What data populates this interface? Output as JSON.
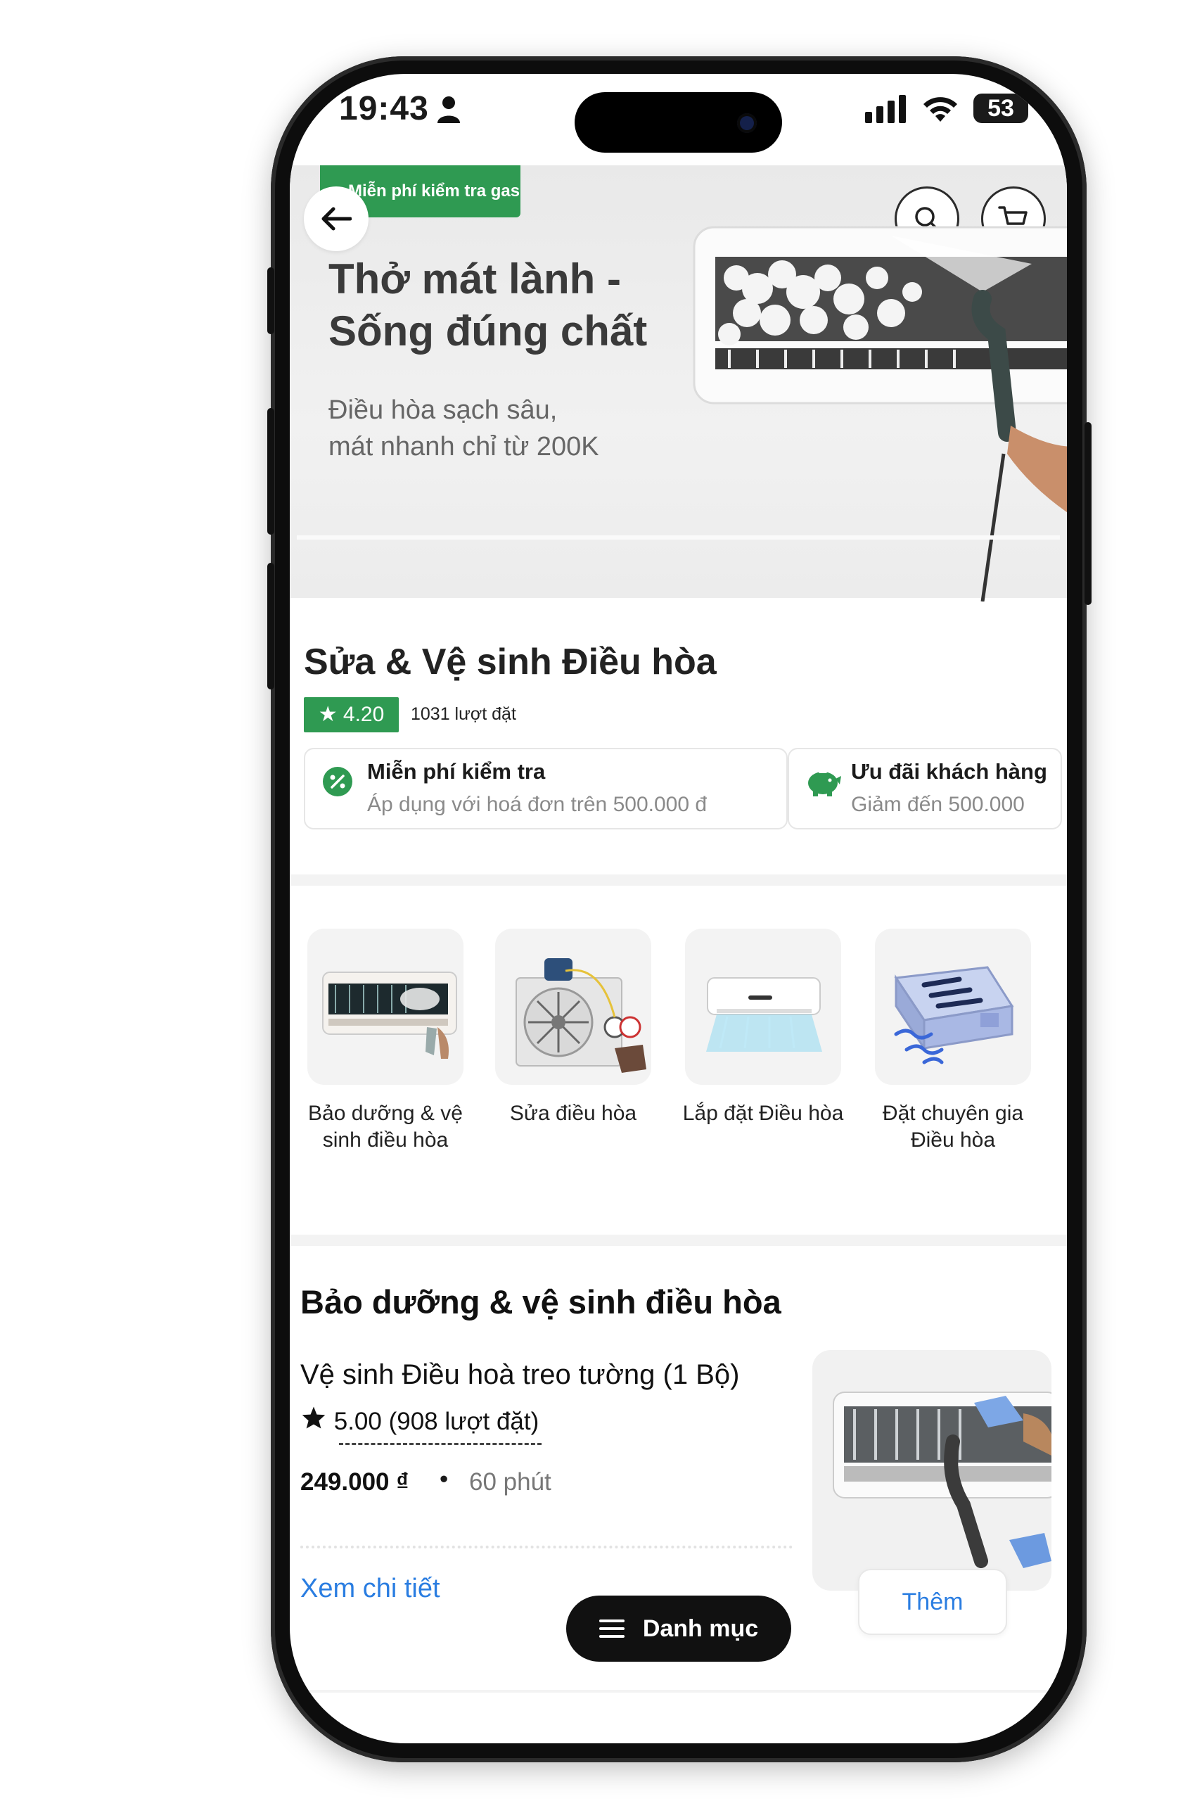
{
  "status_bar": {
    "time": "19:43",
    "battery": "53"
  },
  "hero": {
    "promo_tag": "Miễn phí kiểm tra gas",
    "title_line1": "Thở mát lành -",
    "title_line2": "Sống đúng chất",
    "subtitle_line1": "Điều hòa sạch sâu,",
    "subtitle_line2": "mát nhanh chỉ từ 200K"
  },
  "service": {
    "title": "Sửa & Vệ sinh Điều hòa",
    "rating": "★ 4.20",
    "orders": "1031 lượt đặt"
  },
  "promos": [
    {
      "title": "Miễn phí kiểm tra",
      "subtitle": "Áp dụng với hoá đơn trên 500.000 đ",
      "icon": "discount-icon"
    },
    {
      "title": "Ưu đãi khách hàng",
      "subtitle": "Giảm đến 500.000",
      "icon": "piggy-bank-icon"
    }
  ],
  "categories": [
    {
      "label_line1": "Bảo dưỡng & vệ",
      "label_line2": "sinh điều hòa"
    },
    {
      "label_line1": "Sửa điều hòa",
      "label_line2": ""
    },
    {
      "label_line1": "Lắp đặt Điều hòa",
      "label_line2": ""
    },
    {
      "label_line1": "Đặt chuyên gia",
      "label_line2": "Điều hòa"
    }
  ],
  "product_section": {
    "title": "Bảo dưỡng & vệ sinh điều hòa",
    "product": {
      "name": "Vệ sinh Điều hoà treo tường (1 Bộ)",
      "rating": "5.00 (908 lượt đặt)",
      "price": "249.000 ₫",
      "separator": "•",
      "duration": "60 phút",
      "detail_link": "Xem chi tiết",
      "add_button": "Thêm"
    }
  },
  "bottom_menu": {
    "label": "Danh mục"
  },
  "colors": {
    "brand_green": "#2f9a52",
    "link_blue": "#2a7de1"
  }
}
